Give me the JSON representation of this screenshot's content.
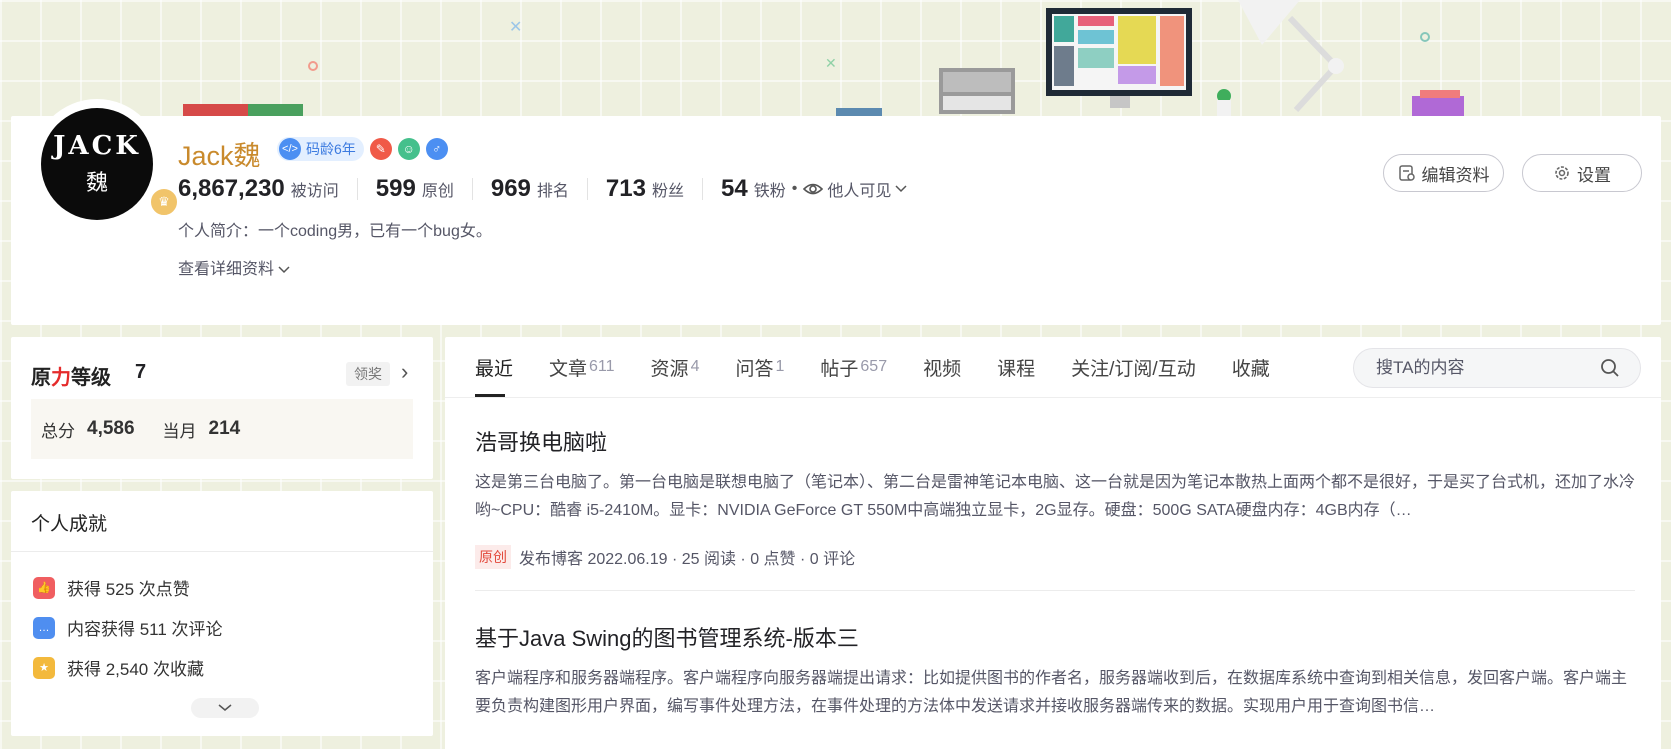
{
  "profile": {
    "name": "Jack魏",
    "avatar_line1": "JACK",
    "avatar_line2": "魏",
    "code_age": "码龄6年",
    "stats": [
      {
        "value": "6,867,230",
        "label": "被访问"
      },
      {
        "value": "599",
        "label": "原创"
      },
      {
        "value": "969",
        "label": "排名"
      },
      {
        "value": "713",
        "label": "粉丝"
      },
      {
        "value": "54",
        "label": "铁粉"
      }
    ],
    "visibility": "他人可见",
    "intro": "个人简介：一个coding男，已有一个bug女。",
    "detail_link": "查看详细资料",
    "edit_button": "编辑资料",
    "settings_button": "设置"
  },
  "level": {
    "title_pre": "原",
    "title_red": "力",
    "title_post": "等级",
    "level": "7",
    "claim": "领奖",
    "total_label": "总分",
    "total": "4,586",
    "month_label": "当月",
    "month": "214"
  },
  "achievements": {
    "title": "个人成就",
    "items": [
      {
        "text": "获得 525 次点赞",
        "icon": "thumb-icon",
        "color": "#f05e60"
      },
      {
        "text": "内容获得 511 次评论",
        "icon": "comment-icon",
        "color": "#4f8ef0"
      },
      {
        "text": "获得 2,540 次收藏",
        "icon": "star-icon",
        "color": "#f3b93c"
      }
    ]
  },
  "tabs": [
    {
      "label": "最近",
      "count": ""
    },
    {
      "label": "文章",
      "count": "611"
    },
    {
      "label": "资源",
      "count": "4"
    },
    {
      "label": "问答",
      "count": "1"
    },
    {
      "label": "帖子",
      "count": "657"
    },
    {
      "label": "视频",
      "count": ""
    },
    {
      "label": "课程",
      "count": ""
    },
    {
      "label": "关注/订阅/互动",
      "count": ""
    },
    {
      "label": "收藏",
      "count": ""
    }
  ],
  "search": {
    "placeholder": "搜TA的内容"
  },
  "articles": [
    {
      "title": "浩哥换电脑啦",
      "desc": "这是第三台电脑了。第一台电脑是联想电脑了（笔记本）、第二台是雷神笔记本电脑、这一台就是因为笔记本散热上面两个都不是很好，于是买了台式机，还加了水冷哟~CPU：酷睿 i5-2410M。显卡：NVIDIA GeForce GT 550M中高端独立显卡，2G显存。硬盘：500G SATA硬盘内存：4GB内存（…",
      "tag": "原创",
      "meta": "发布博客 2022.06.19 ·  25 阅读 ·  0 点赞 ·  0 评论"
    },
    {
      "title": "基于Java Swing的图书管理系统-版本三",
      "desc": "客户端程序和服务器端程序。客户端程序向服务器端提出请求：比如提供图书的作者名，服务器端收到后，在数据库系统中查询到相关信息，发回客户端。客户端主要负责构建图形用户界面，编写事件处理方法，在事件处理的方法体中发送请求并接收服务器端传来的数据。实现用户用于查询图书信…",
      "tag": "",
      "meta": ""
    }
  ]
}
